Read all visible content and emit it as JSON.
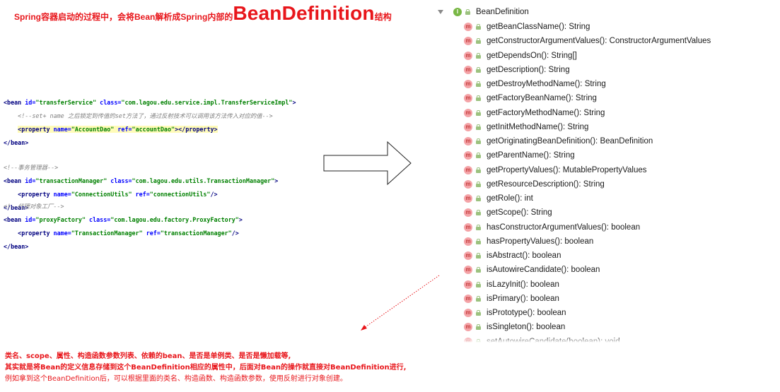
{
  "title": {
    "prefix": "Spring容器启动的过程中，会将Bean解析成Spring内部的",
    "emphasis": "BeanDefinition",
    "suffix": "结构"
  },
  "xml": {
    "block1": {
      "bean_open": "<bean ",
      "id_attr": "id=",
      "id_val": "\"transferService\"",
      "class_attr": " class=",
      "class_val": "\"com.lagou.edu.service.impl.TransferServiceImpl\"",
      "bean_open_end": ">",
      "comment": "<!--set+ name 之后锁定到传值的set方法了，通过反射技术可以调用该方法传入对应的值-->",
      "prop_open": "<property ",
      "name_attr": "name=",
      "name_val": "\"AccountDao\"",
      "ref_attr": " ref=",
      "ref_val": "\"accountDao\"",
      "prop_close": "></property>",
      "bean_close": "</bean>"
    },
    "block2": {
      "comment": "<!--事务管理器-->",
      "bean_open": "<bean ",
      "id_attr": "id=",
      "id_val": "\"transactionManager\"",
      "class_attr": " class=",
      "class_val": "\"com.lagou.edu.utils.TransactionManager\"",
      "bean_open_end": ">",
      "prop_open": "<property ",
      "name_attr": "name=",
      "name_val": "\"ConnectionUtils\"",
      "ref_attr": " ref=",
      "ref_val": "\"connectionUtils\"",
      "prop_close": "/>",
      "bean_close": "</bean>"
    },
    "block3": {
      "comment": "<!--代理对象工厂-->",
      "bean_open": "<bean ",
      "id_attr": "id=",
      "id_val": "\"proxyFactory\"",
      "class_attr": " class=",
      "class_val": "\"com.lagou.edu.factory.ProxyFactory\"",
      "bean_open_end": ">",
      "prop_open": "<property ",
      "name_attr": "name=",
      "name_val": "\"TransactionManager\"",
      "ref_attr": " ref=",
      "ref_val": "\"transactionManager\"",
      "prop_close": "/>",
      "bean_close": "</bean>"
    }
  },
  "tree": {
    "root_label": "BeanDefinition",
    "interface_badge": "I",
    "method_badge": "m",
    "methods": [
      "getBeanClassName(): String",
      "getConstructorArgumentValues(): ConstructorArgumentValues",
      "getDependsOn(): String[]",
      "getDescription(): String",
      "getDestroyMethodName(): String",
      "getFactoryBeanName(): String",
      "getFactoryMethodName(): String",
      "getInitMethodName(): String",
      "getOriginatingBeanDefinition(): BeanDefinition",
      "getParentName(): String",
      "getPropertyValues(): MutablePropertyValues",
      "getResourceDescription(): String",
      "getRole(): int",
      "getScope(): String",
      "hasConstructorArgumentValues(): boolean",
      "hasPropertyValues(): boolean",
      "isAbstract(): boolean",
      "isAutowireCandidate(): boolean",
      "isLazyInit(): boolean",
      "isPrimary(): boolean",
      "isPrototype(): boolean",
      "isSingleton(): boolean",
      "setAutowireCandidate(boolean): void"
    ]
  },
  "notes": {
    "line1": "类名、scope、属性、构造函数参数列表、依赖的bean、是否是单例类、是否是懒加载等,",
    "line2": "其实就是将Bean的定义信息存储到这个BeanDefinition相应的属性中，后面对Bean的操作就直接对BeanDefinition进行,",
    "line3": "例如拿到这个BeanDefinition后，可以根据里面的类名、构造函数、构造函数参数，使用反射进行对象创建。"
  },
  "colors": {
    "accent_red": "#e8161b",
    "xml_tag": "#000080",
    "xml_attr": "#0000ff",
    "xml_value": "#008000",
    "xml_comment": "#808080",
    "interface_icon": "#79b745",
    "method_icon": "#f4a3a7"
  }
}
